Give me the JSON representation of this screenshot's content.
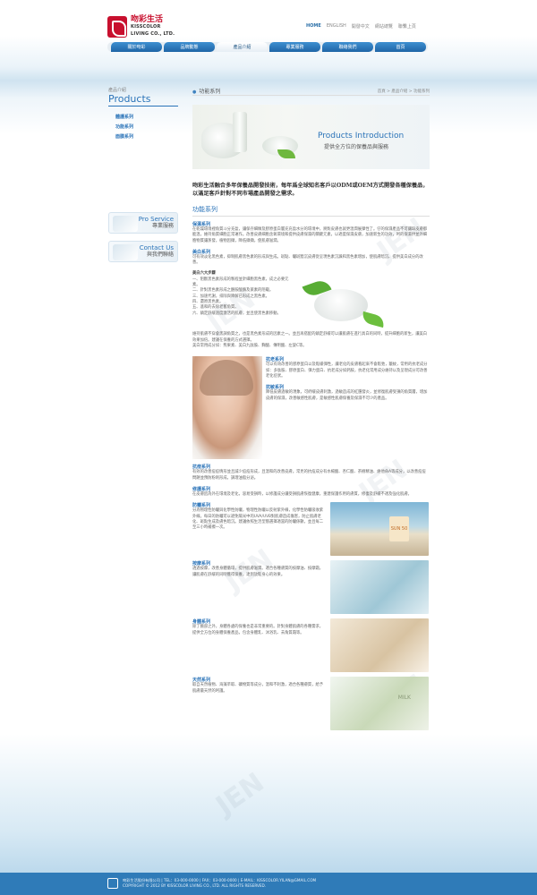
{
  "brand": {
    "name_cn": "吻彩生活",
    "name_en": "KISSCOLOR",
    "name_en2": "LIVING CO., LTD."
  },
  "toplinks": [
    "HOME",
    "ENGLISH",
    "開發中文",
    "網站總覽",
    "聯繫上頁"
  ],
  "nav": [
    "關於吻彩",
    "品牌動態",
    "產品介紹",
    "專業服務",
    "聯絡我們",
    "首頁"
  ],
  "sidebar": {
    "title_cn": "產品介紹",
    "title_en": "Products",
    "items": [
      "體護系列",
      "功能系列",
      "面膜系列"
    ],
    "banner1": {
      "en": "Pro Service",
      "cn": "專業服務"
    },
    "banner2": {
      "en": "Contact Us",
      "cn": "與我們聯絡"
    }
  },
  "main": {
    "page_title": "功能系列",
    "breadcrumb": "首頁 > 產品介紹 > 功能系列",
    "hero_en": "Products Introduction",
    "hero_cn": "提供全方位的保養品與服務",
    "intro": "吻彩生活融合多年保養品開發技術，每年爲全球知名客戶以ODM或OEM方式開發各種保養品，以滿足客戶針對不同市場產品開發之需求。",
    "section_title": "功能系列",
    "s1_title": "保濕系列",
    "s1_text": "在乾燥環境裡角質斗分充盈，讓保存細緻及膠原蛋白層充充盈水分的環境中，將對皮膚也就更溫潤展彈性了。仔的保濕產品不可讓缺皮膚都能溫，維持角質細胞正常運作。改善皮膚細胞含氧環境和提供皮膚保濕的關鍵元素，以適度保濕皮膚，加速新生的功效，呵的保濕供並外細胞物質讓蒸發，植物因擷，降低擷擷，使肌膚滋潤。",
    "s2_title": "美白系列",
    "s2_text": "可有效淡化黑色素，抑制肌膚黑色素的形成與生成。斑點、曬斑黯沉皮膚從呈現色素沉澱和黑色素增加，使肌膚暗沉、提供美白成分的改善。",
    "wh_head": "美白六大步驟",
    "wh_list": [
      "一、阻斷黑色素形成的製程並針細胞黑色素，成之必要元素。",
      "二、針對黑色素形成之酪胺酸酶及萊素的阻礙。",
      "三、加速代謝，排除與降解已形成之黑色素。",
      "四、還原黑色素。",
      "五、遙和的去除老舊角質。",
      "六、鎮定舒緩過度激活的肌膚，並且使黑色素移動。"
    ],
    "wh_after": "維持肌膚不穿會黑調角質之，也是黑色素形成的因素之一。並且再搭配的鎮定舒緩可以讓肌膚在進行具白的同時，提升細胞的新生，讓美白效果加倍。建議在保養的方式選擇。",
    "wh_after2": "美白常用成分如：熊果素、美白九肽胺、麴酸、傳明酸、左旋C等。",
    "s3_title": "抗老系列",
    "s3_text": "可以有效改善的膠原蛋白以及鬆緩彈性，讓老化的皮膚看起來不會鬆弛，皺紋，常用的抗老成分如：多肽胺、膠原蛋白、彈力蛋白、抗老成分如鈣胺，抗老化常用成分維持以及呈現成分可改善老化症狀。",
    "s4_title": "抗敏系列",
    "s4_text": "降低皮膚過敏的現象，可紓緩皮膚刺激，過敏造成的紅腫發炎，並修復肌膚受損的角質層，增加皮膚的保濕，改善敏感性肌膚，是敏感性肌膚保養及保濕不可少的產品。",
    "s5_title": "抗痘系列",
    "s5_text": "有效的改善痘痘情形並且減少痘痘形成，且溫和的改善皮膚。常見的抗痘成分有水楊酸、杏仁酸、茶樹精油、維他命A等成分，以改善痘痘問題並預防粉刺形成，調理油脂分泌。",
    "s6_title": "修護系列",
    "s6_text": "在皮膚因為外在環境及老化，容易受損時，以修護成分讓受損肌膚恢復健康，重建保護作用的膚質，修復及舒緩不適及強化肌膚。",
    "s7_title": "防曬系列",
    "s7_text": "分為物理性防曬與化學性防曬，物理性防曬以反射紫外線，化學性防曬吸收紫外線。每日的防曬可以避免陽光中的UVA/UVB對肌膚造成傷害，防止肌膚老化、斑點生成及膚色暗沉。建議依照生活型態選擇適當的防曬係數，並且每二至三小時補擦一次。",
    "s8_title": "按摩系列",
    "s8_text": "透過按摩，改善身體循環，提供肌膚滋潤。適合各種膚質的按摩油、按摩霜，讓肌膚在舒緩的同時獲得保養，達到放鬆身心的效果。",
    "s9_title": "身體系列",
    "s9_text": "除了臉部之外，身體各處的保養也是非常重要的。針對身體肌膚的各種需求，提供全方位的身體保養產品，包含身體乳、沐浴乳、去角質霜等。",
    "s10_title": "天然系列",
    "s10_text": "取自天然植物、海藻萃取、礦物質等成分，溫和不刺激，適合各種膚質，給予肌膚最天然的呵護。"
  },
  "footer": {
    "line1": "吻彩生活股份有限公司 | TEL：03-000-0000 | FAX：03-000-0000 | E-MAIL：KISSCOLOR.YILAN@GMAIL.COM",
    "line2": "COPYRIGHT © 2012 BY KISSCOLOR LIVING CO., LTD. ALL RIGHTS RESERVED."
  }
}
